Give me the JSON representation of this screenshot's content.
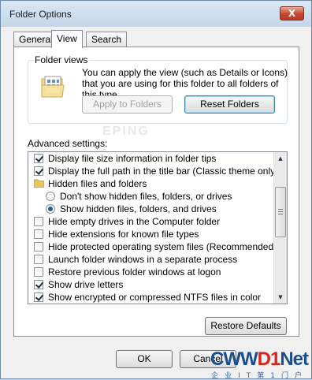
{
  "window": {
    "title": "Folder Options",
    "close_glyph": "X"
  },
  "tabs": [
    {
      "label": "General",
      "active": false
    },
    {
      "label": "View",
      "active": true
    },
    {
      "label": "Search",
      "active": false
    }
  ],
  "folder_views": {
    "label": "Folder views",
    "description": "You can apply the view (such as Details or Icons) that you are using for this folder to all folders of this type.",
    "icon": "folder-view-icon",
    "apply_label": "Apply to Folders",
    "reset_label": "Reset Folders"
  },
  "advanced": {
    "label": "Advanced settings:",
    "items": [
      {
        "kind": "checkbox",
        "checked": true,
        "label": "Display file size information in folder tips",
        "indent": 0
      },
      {
        "kind": "checkbox",
        "checked": true,
        "label": "Display the full path in the title bar (Classic theme only)",
        "indent": 0
      },
      {
        "kind": "folder",
        "label": "Hidden files and folders",
        "indent": 0
      },
      {
        "kind": "radio",
        "checked": false,
        "label": "Don't show hidden files, folders, or drives",
        "indent": 1
      },
      {
        "kind": "radio",
        "checked": true,
        "label": "Show hidden files, folders, and drives",
        "indent": 1
      },
      {
        "kind": "checkbox",
        "checked": false,
        "label": "Hide empty drives in the Computer folder",
        "indent": 0
      },
      {
        "kind": "checkbox",
        "checked": false,
        "label": "Hide extensions for known file types",
        "indent": 0
      },
      {
        "kind": "checkbox",
        "checked": false,
        "label": "Hide protected operating system files (Recommended)",
        "indent": 0
      },
      {
        "kind": "checkbox",
        "checked": false,
        "label": "Launch folder windows in a separate process",
        "indent": 0
      },
      {
        "kind": "checkbox",
        "checked": false,
        "label": "Restore previous folder windows at logon",
        "indent": 0
      },
      {
        "kind": "checkbox",
        "checked": true,
        "label": "Show drive letters",
        "indent": 0
      },
      {
        "kind": "checkbox",
        "checked": true,
        "label": "Show encrypted or compressed NTFS files in color",
        "indent": 0
      }
    ],
    "restore_label": "Restore Defaults"
  },
  "footer": {
    "ok_label": "OK",
    "cancel_label": "Cancel"
  },
  "watermark": {
    "faint": "EPING",
    "main_a": "CWW",
    "main_b": "D1",
    "main_c": "Net",
    "sub": "企业IT第1门户"
  },
  "colors": {
    "accent": "#3c7fb1",
    "title_bar": "#c3d6ea",
    "close": "#c9452f"
  }
}
